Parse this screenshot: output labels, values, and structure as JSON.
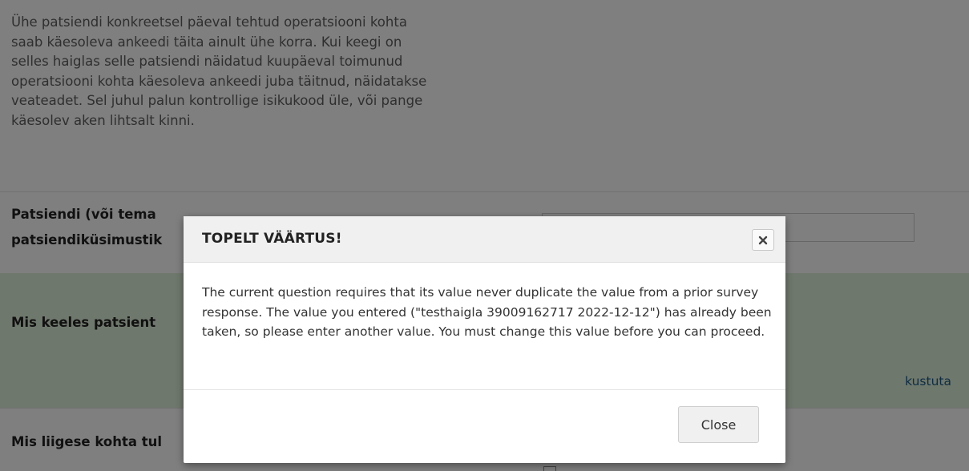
{
  "intro": {
    "paragraph_lines": [
      "Ühe patsiendi konkreetsel päeval tehtud operatsiooni kohta",
      "saab käesoleva ankeedi täita ainult ühe korra. Kui keegi on",
      "selles haiglas selle patsiendi näidatud kuupäeval toimunud",
      "operatsiooni kohta käesoleva ankeedi juba täitnud, näidatakse",
      "veateadet. Sel juhul palun kontrollige isikukood üle, või pange",
      "käesolev aken lihtsalt kinni."
    ]
  },
  "questions": {
    "patient_line1": "Patsiendi (või tema",
    "patient_line2": "patsiendiküsimustik",
    "language": "Mis keeles patsient",
    "joint": "Mis liigese kohta tul"
  },
  "language_row": {
    "delete_link": "kustuta",
    "bg_color": "#dff0d8"
  },
  "modal": {
    "title": "TOPELT VÄÄRTUS!",
    "close_icon": "close-x-icon",
    "message": "The current question requires that its value never duplicate the value from a prior survey response. The value you entered (\"testhaigla 39009162717 2022-12-12\") has already been taken, so please enter another value. You must change this value before you can proceed.",
    "close_button": "Close"
  }
}
